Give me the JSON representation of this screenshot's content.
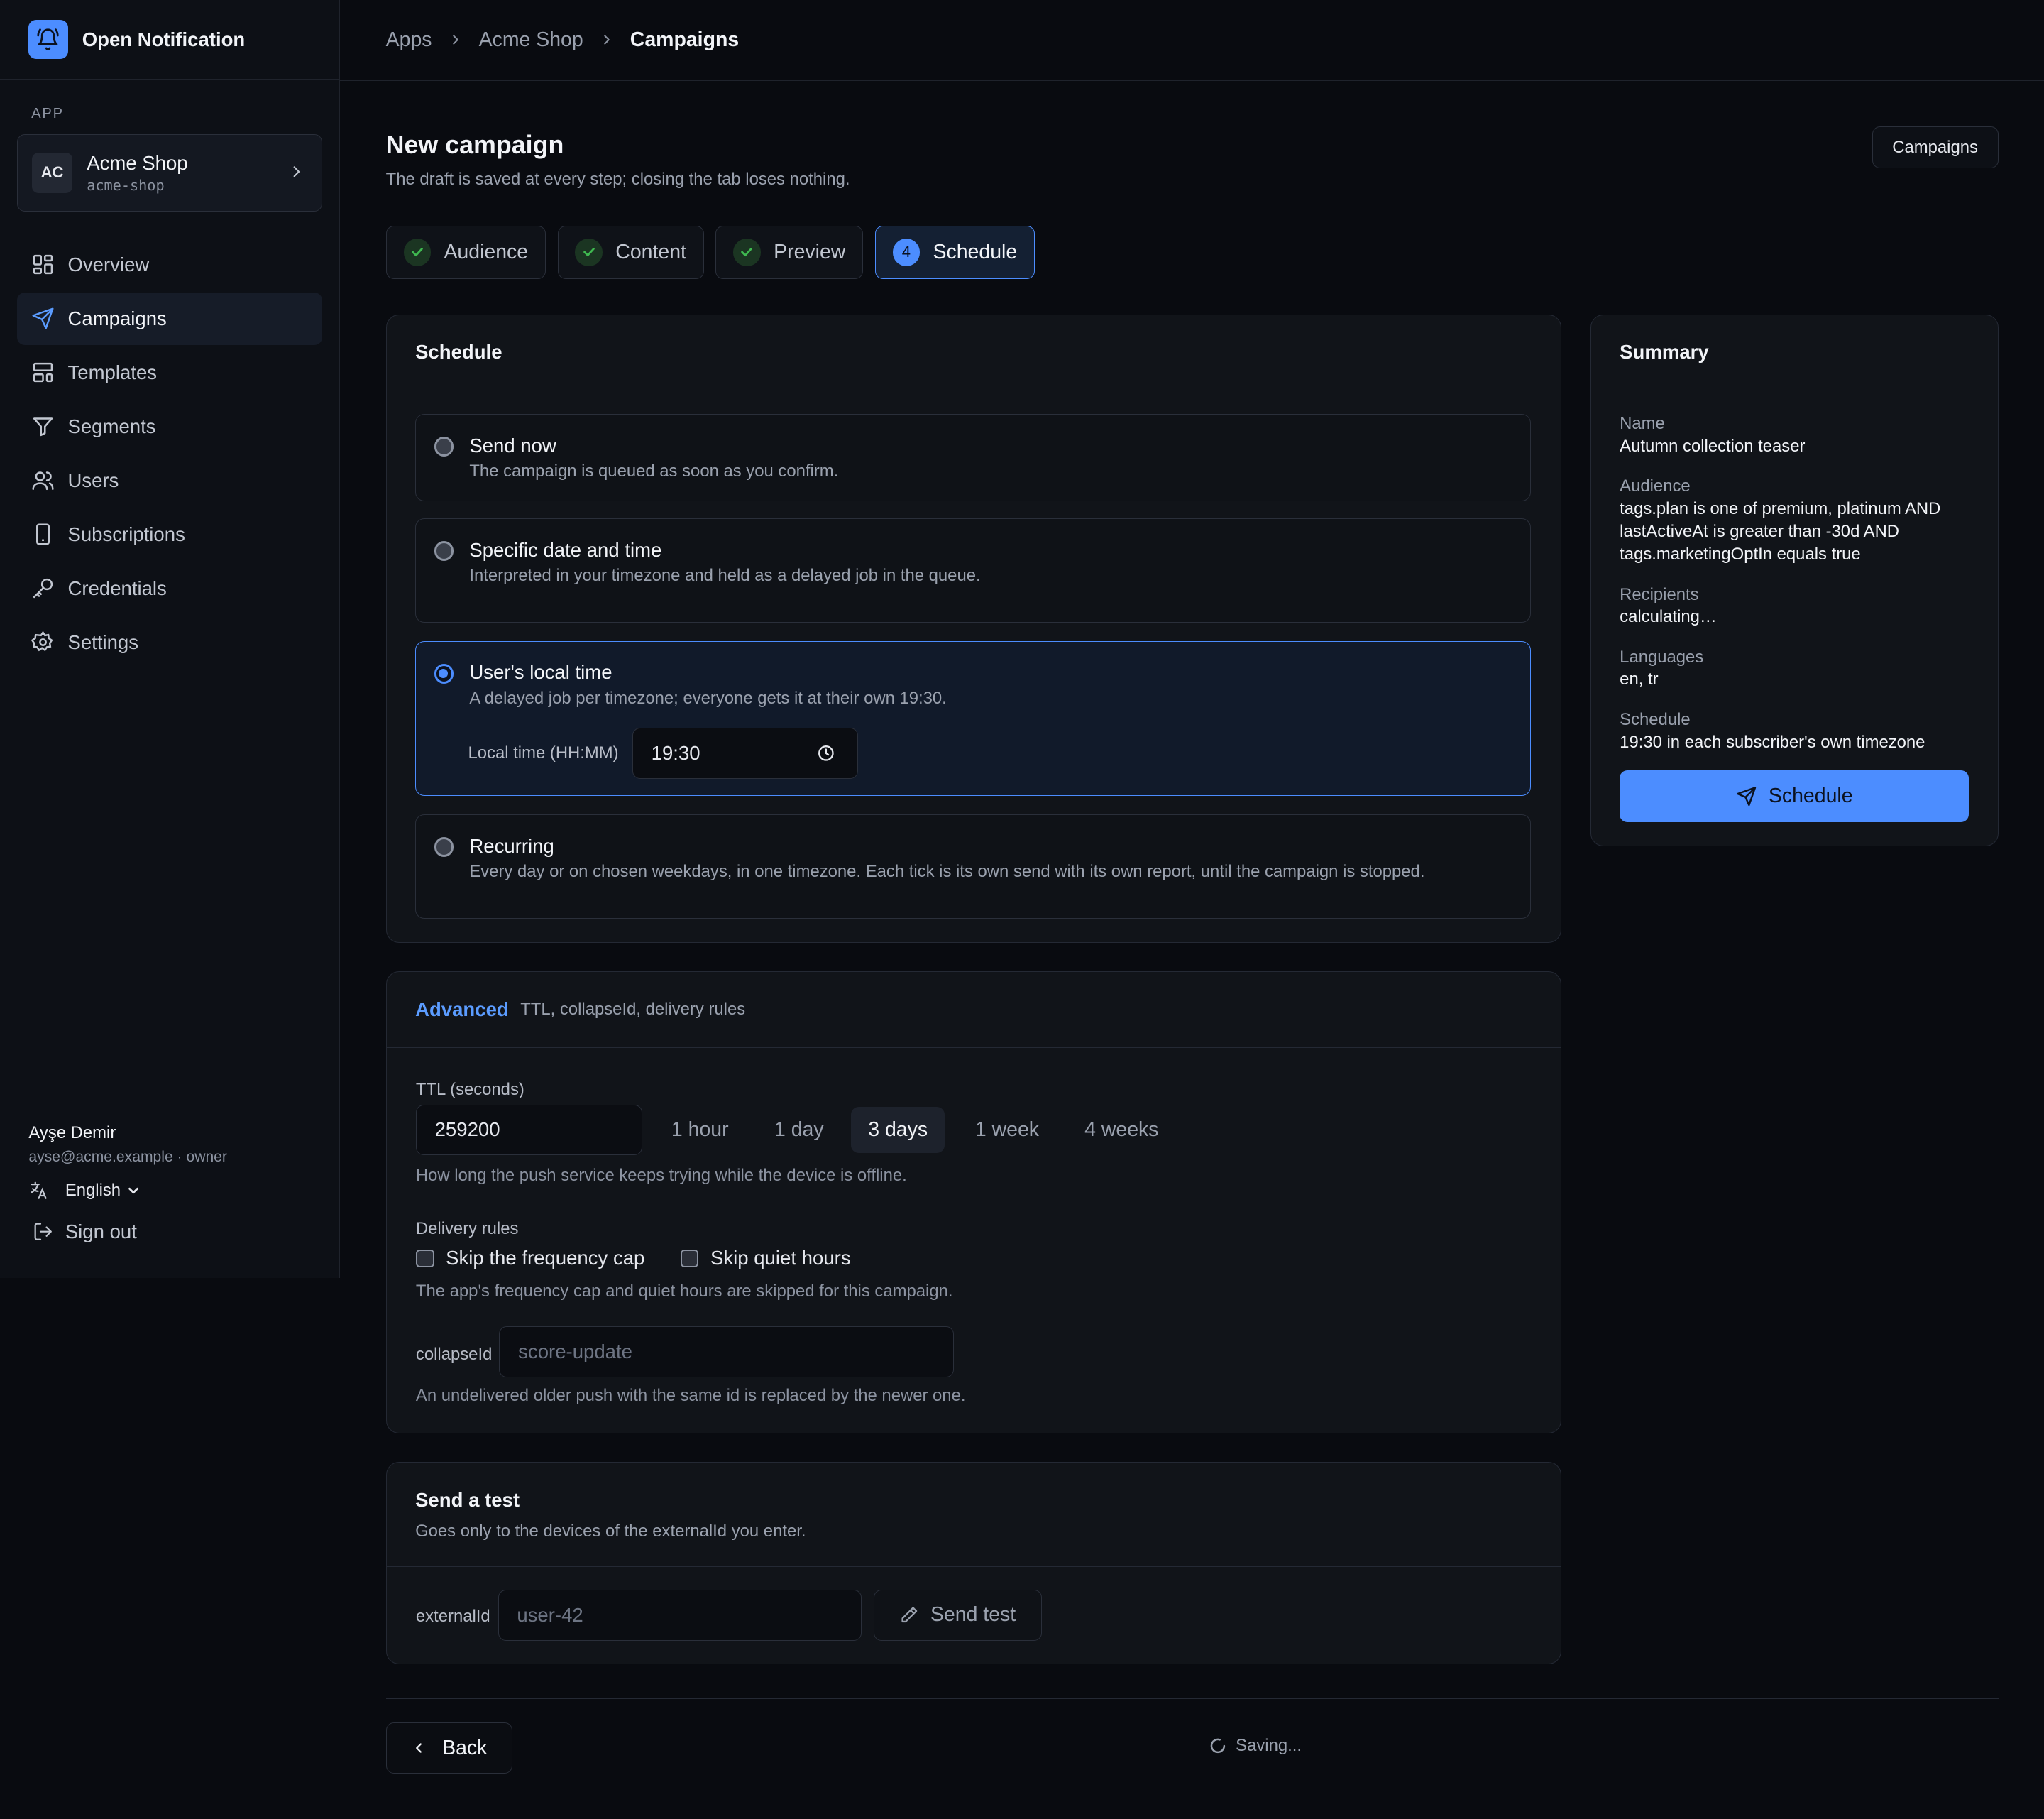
{
  "brand": {
    "name": "Open Notification"
  },
  "sidebar": {
    "section_label": "APP",
    "app": {
      "initials": "AC",
      "name": "Acme Shop",
      "slug": "acme-shop"
    },
    "items": [
      {
        "label": "Overview",
        "icon": "grid-icon"
      },
      {
        "label": "Campaigns",
        "icon": "send-icon",
        "active": true
      },
      {
        "label": "Templates",
        "icon": "template-icon"
      },
      {
        "label": "Segments",
        "icon": "filter-icon"
      },
      {
        "label": "Users",
        "icon": "users-icon"
      },
      {
        "label": "Subscriptions",
        "icon": "device-icon"
      },
      {
        "label": "Credentials",
        "icon": "key-icon"
      },
      {
        "label": "Settings",
        "icon": "gear-icon"
      }
    ],
    "user": {
      "name": "Ayşe Demir",
      "meta": "ayse@acme.example · owner"
    },
    "language": "English",
    "sign_out": "Sign out"
  },
  "breadcrumb": [
    "Apps",
    "Acme Shop",
    "Campaigns"
  ],
  "header": {
    "title": "New campaign",
    "subtitle": "The draft is saved at every step; closing the tab loses nothing.",
    "campaigns_button": "Campaigns"
  },
  "steps": [
    {
      "label": "Audience",
      "state": "done"
    },
    {
      "label": "Content",
      "state": "done"
    },
    {
      "label": "Preview",
      "state": "done"
    },
    {
      "label": "Schedule",
      "state": "current",
      "number": "4"
    }
  ],
  "schedule": {
    "title": "Schedule",
    "options": [
      {
        "title": "Send now",
        "desc": "The campaign is queued as soon as you confirm."
      },
      {
        "title": "Specific date and time",
        "desc": "Interpreted in your timezone and held as a delayed job in the queue."
      },
      {
        "title": "User's local time",
        "desc": "A delayed job per timezone; everyone gets it at their own 19:30.",
        "selected": true
      },
      {
        "title": "Recurring",
        "desc": "Every day or on chosen weekdays, in one timezone. Each tick is its own send with its own report, until the campaign is stopped."
      }
    ],
    "local_time_label": "Local time (HH:MM)",
    "local_time_value": "19:30"
  },
  "advanced": {
    "title": "Advanced",
    "subtitle": "TTL, collapseId, delivery rules",
    "ttl_label": "TTL (seconds)",
    "ttl_value": "259200",
    "presets": [
      "1 hour",
      "1 day",
      "3 days",
      "1 week",
      "4 weeks"
    ],
    "preset_selected": "3 days",
    "ttl_help": "How long the push service keeps trying while the device is offline.",
    "delivery_label": "Delivery rules",
    "skip_cap": "Skip the frequency cap",
    "skip_quiet": "Skip quiet hours",
    "delivery_help": "The app's frequency cap and quiet hours are skipped for this campaign.",
    "collapse_label": "collapseId",
    "collapse_placeholder": "score-update",
    "collapse_help": "An undelivered older push with the same id is replaced by the newer one."
  },
  "test": {
    "title": "Send a test",
    "subtitle": "Goes only to the devices of the externalId you enter.",
    "external_label": "externalId",
    "external_placeholder": "user-42",
    "send_button": "Send test"
  },
  "summary": {
    "title": "Summary",
    "name_label": "Name",
    "name": "Autumn collection teaser",
    "audience_label": "Audience",
    "audience": "tags.plan is one of premium, platinum AND lastActiveAt is greater than -30d AND tags.marketingOptIn equals true",
    "recipients_label": "Recipients",
    "recipients": "calculating…",
    "languages_label": "Languages",
    "languages": "en, tr",
    "schedule_label": "Schedule",
    "schedule": "19:30 in each subscriber's own timezone",
    "schedule_button": "Schedule"
  },
  "footer": {
    "back": "Back",
    "status": "Saving..."
  },
  "colors": {
    "accent": "#4c8dff",
    "bg": "#090b10",
    "success": "#3fb950"
  }
}
